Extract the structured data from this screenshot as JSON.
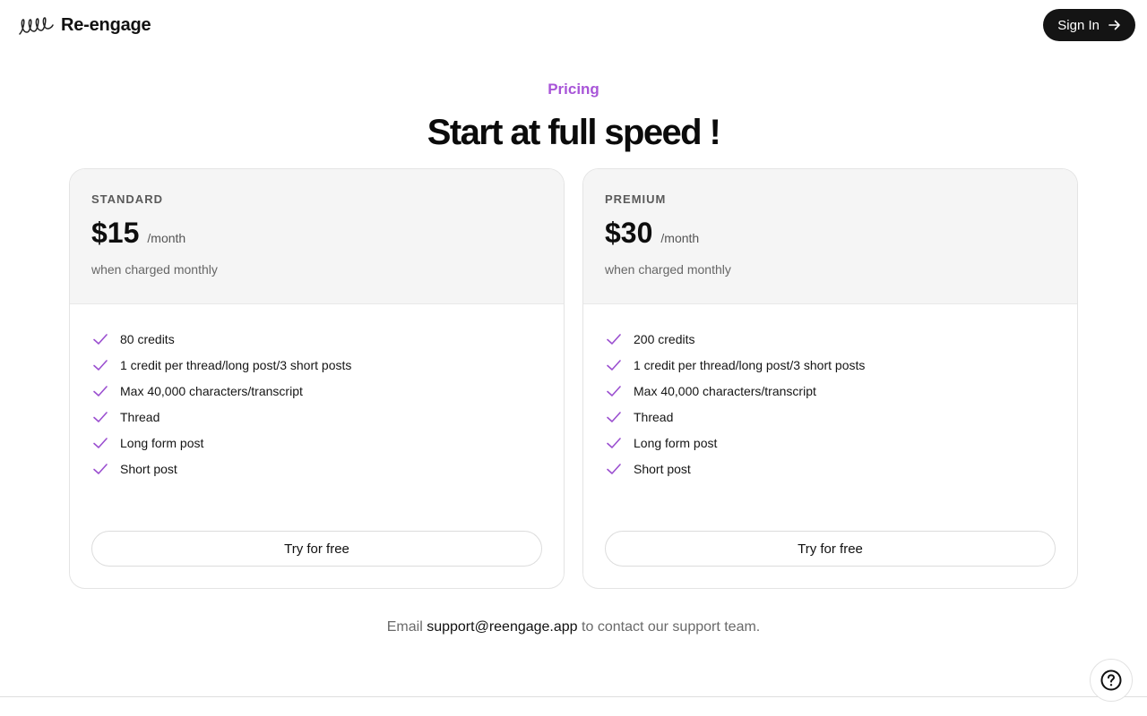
{
  "header": {
    "logo_text": "Re-engage",
    "signin_label": "Sign In"
  },
  "hero": {
    "eyebrow": "Pricing",
    "title": "Start at full speed !"
  },
  "plans": [
    {
      "tier": "STANDARD",
      "price": "$15",
      "period": "/month",
      "billing_note": "when charged monthly",
      "features": [
        "80 credits",
        "1 credit per thread/long post/3 short posts",
        "Max 40,000 characters/transcript",
        "Thread",
        "Long form post",
        "Short post"
      ],
      "cta_label": "Try for free"
    },
    {
      "tier": "PREMIUM",
      "price": "$30",
      "period": "/month",
      "billing_note": "when charged monthly",
      "features": [
        "200 credits",
        "1 credit per thread/long post/3 short posts",
        "Max 40,000 characters/transcript",
        "Thread",
        "Long form post",
        "Short post"
      ],
      "cta_label": "Try for free"
    }
  ],
  "support": {
    "prefix": "Email",
    "email": "support@reengage.app",
    "suffix": "to contact our support team."
  },
  "colors": {
    "accent": "#a855d8",
    "check": "#9b4fd0",
    "signin_bg": "#141414",
    "card_header_bg": "#f5f5f5"
  },
  "icons": {
    "logo": "loops-logo-icon",
    "signin": "arrow-right-icon",
    "feature": "check-icon",
    "help": "question-circle-icon"
  }
}
